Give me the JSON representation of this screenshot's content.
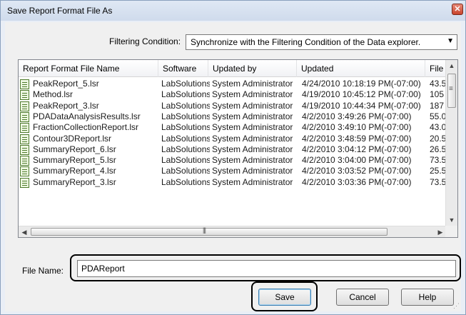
{
  "dialog": {
    "title": "Save Report Format File As",
    "close_glyph": "✕"
  },
  "filter": {
    "label": "Filtering Condition:",
    "selected": "Synchronize with the Filtering Condition of the Data explorer."
  },
  "list": {
    "columns": [
      "Report Format File Name",
      "Software",
      "Updated by",
      "Updated",
      "File"
    ],
    "rows": [
      [
        "PeakReport_5.lsr",
        "LabSolutions",
        "System Administrator",
        "4/24/2010 10:18:19 PM(-07:00)",
        "43.5"
      ],
      [
        "Method.lsr",
        "LabSolutions",
        "System Administrator",
        "4/19/2010 10:45:12 PM(-07:00)",
        "105"
      ],
      [
        "PeakReport_3.lsr",
        "LabSolutions",
        "System Administrator",
        "4/19/2010 10:44:34 PM(-07:00)",
        "187"
      ],
      [
        "PDADataAnalysisResults.lsr",
        "LabSolutions",
        "System Administrator",
        "4/2/2010 3:49:26 PM(-07:00)",
        "55.0"
      ],
      [
        "FractionCollectionReport.lsr",
        "LabSolutions",
        "System Administrator",
        "4/2/2010 3:49:10 PM(-07:00)",
        "43.0"
      ],
      [
        "Contour3DReport.lsr",
        "LabSolutions",
        "System Administrator",
        "4/2/2010 3:48:59 PM(-07:00)",
        "20.5"
      ],
      [
        "SummaryReport_6.lsr",
        "LabSolutions",
        "System Administrator",
        "4/2/2010 3:04:12 PM(-07:00)",
        "26.5"
      ],
      [
        "SummaryReport_5.lsr",
        "LabSolutions",
        "System Administrator",
        "4/2/2010 3:04:00 PM(-07:00)",
        "73.5"
      ],
      [
        "SummaryReport_4.lsr",
        "LabSolutions",
        "System Administrator",
        "4/2/2010 3:03:52 PM(-07:00)",
        "25.5"
      ],
      [
        "SummaryReport_3.lsr",
        "LabSolutions",
        "System Administrator",
        "4/2/2010 3:03:36 PM(-07:00)",
        "73.5"
      ]
    ]
  },
  "filename": {
    "label": "File Name:",
    "value": "PDAReport"
  },
  "buttons": {
    "save": "Save",
    "cancel": "Cancel",
    "help": "Help"
  },
  "colors": {
    "dialog_bg": "#f0f0f0",
    "titlebar": "#dfe8f4",
    "close_red": "#c8442c",
    "file_icon_green": "#4d7a2b"
  }
}
